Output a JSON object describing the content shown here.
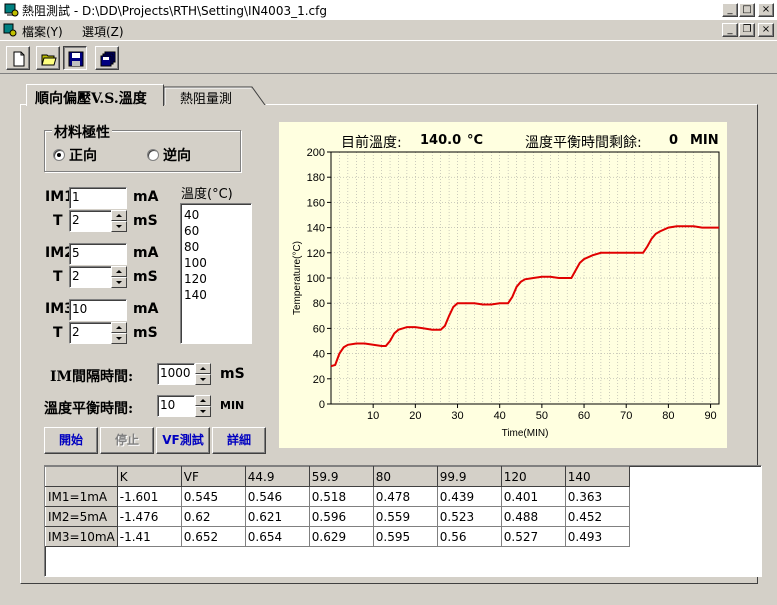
{
  "window": {
    "title": "熱阻測試 - D:\\DD\\Projects\\RTH\\Setting\\IN4003_1.cfg"
  },
  "menu": {
    "file": "檔案(Y)",
    "options": "選項(Z)"
  },
  "toolbar": {
    "icons": [
      "new-file-icon",
      "open-folder-icon",
      "save-disk-icon",
      "save-all-icon"
    ]
  },
  "tabs": {
    "tab1": "順向偏壓V.S.溫度",
    "tab2": "熱阻量測"
  },
  "polarity": {
    "title": "材料極性",
    "forward": "正向",
    "reverse": "逆向",
    "selected": "forward"
  },
  "currents": [
    {
      "label": "IM1",
      "value": "1",
      "unit": "mA",
      "t_label": "T",
      "t_value": "2",
      "t_unit": "mS"
    },
    {
      "label": "IM2",
      "value": "5",
      "unit": "mA",
      "t_label": "T",
      "t_value": "2",
      "t_unit": "mS"
    },
    {
      "label": "IM3",
      "value": "10",
      "unit": "mA",
      "t_label": "T",
      "t_value": "2",
      "t_unit": "mS"
    }
  ],
  "temps": {
    "title": "溫度(°C)",
    "items": [
      "40",
      "60",
      "80",
      "100",
      "120",
      "140"
    ]
  },
  "interval": {
    "label": "IM間隔時間:",
    "value": "1000",
    "unit": "mS"
  },
  "balance": {
    "label": "溫度平衡時間:",
    "value": "10",
    "unit": "MIN"
  },
  "buttons": {
    "start": "開始",
    "stop": "停止",
    "vf": "VF測試",
    "detail": "詳細"
  },
  "status": {
    "temp_label": "目前溫度:",
    "temp_value": "140.0",
    "temp_unit": "°C",
    "remain_label": "溫度平衡時間剩餘:",
    "remain_value": "0",
    "remain_unit": "MIN"
  },
  "chart_data": {
    "type": "line",
    "xlabel": "Time(MIN)",
    "ylabel": "Temperature(°C)",
    "xlim": [
      0,
      92
    ],
    "ylim": [
      0,
      200
    ],
    "xticks": [
      "10",
      "20",
      "30",
      "40",
      "50",
      "60",
      "70",
      "80",
      "90"
    ],
    "yticks": [
      "0",
      "20",
      "40",
      "60",
      "80",
      "100",
      "120",
      "140",
      "160",
      "180",
      "200"
    ],
    "grid": true,
    "series": [
      {
        "color": "#e00000",
        "x": [
          0,
          1,
          2,
          3,
          4,
          6,
          8,
          10,
          12,
          13,
          14,
          15,
          16,
          17,
          18,
          20,
          22,
          24,
          26,
          27,
          28,
          29,
          30,
          31,
          32,
          34,
          36,
          38,
          40,
          42,
          43,
          44,
          45,
          46,
          48,
          50,
          52,
          54,
          56,
          57,
          58,
          59,
          60,
          62,
          64,
          66,
          68,
          70,
          72,
          73,
          74,
          75,
          76,
          77,
          78,
          80,
          82,
          84,
          86,
          88,
          90,
          92
        ],
        "y": [
          30,
          31,
          40,
          45,
          47,
          48,
          48,
          47,
          46,
          46,
          50,
          56,
          59,
          60,
          61,
          61,
          60,
          59,
          59,
          62,
          70,
          77,
          80,
          80,
          80,
          80,
          79,
          79,
          80,
          80,
          85,
          93,
          97,
          99,
          100,
          101,
          101,
          100,
          100,
          100,
          106,
          112,
          115,
          118,
          120,
          120,
          120,
          120,
          120,
          120,
          120,
          125,
          131,
          135,
          137,
          140,
          141,
          141,
          141,
          140,
          140,
          140
        ]
      }
    ]
  },
  "table": {
    "header": [
      "",
      "K",
      "VF",
      "44.9",
      "59.9",
      "80",
      "99.9",
      "120",
      "140"
    ],
    "rows": [
      [
        "IM1=1mA",
        "-1.601",
        "0.545",
        "0.546",
        "0.518",
        "0.478",
        "0.439",
        "0.401",
        "0.363"
      ],
      [
        "IM2=5mA",
        "-1.476",
        "0.62",
        "0.621",
        "0.596",
        "0.559",
        "0.523",
        "0.488",
        "0.452"
      ],
      [
        "IM3=10mA",
        "-1.41",
        "0.652",
        "0.654",
        "0.629",
        "0.595",
        "0.56",
        "0.527",
        "0.493"
      ]
    ]
  }
}
